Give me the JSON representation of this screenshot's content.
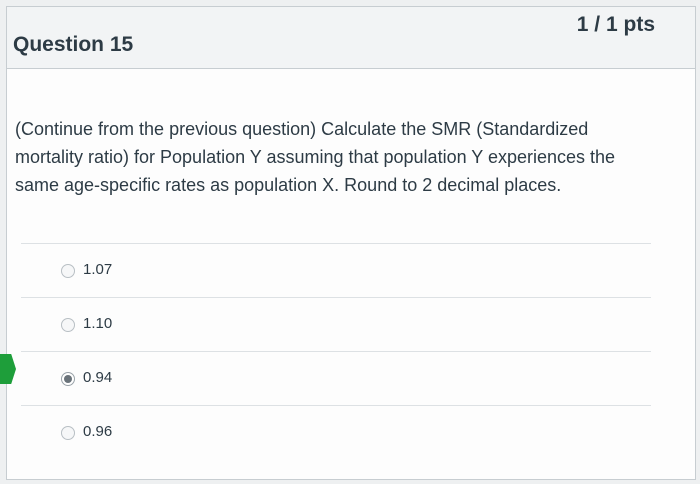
{
  "question": {
    "title": "Question 15",
    "points": "1 / 1 pts",
    "text": "(Continue from the previous question) Calculate the SMR (Standardized mortality ratio) for Population Y assuming that population Y experiences the same age-specific rates as population X.  Round to 2 decimal places."
  },
  "answers": [
    {
      "label": "1.07",
      "selected": false
    },
    {
      "label": "1.10",
      "selected": false
    },
    {
      "label": "0.94",
      "selected": true
    },
    {
      "label": "0.96",
      "selected": false
    }
  ],
  "colors": {
    "correct_flag": "#1e9e3a",
    "text": "#2d3b45",
    "header_bg": "#f2f4f5"
  }
}
